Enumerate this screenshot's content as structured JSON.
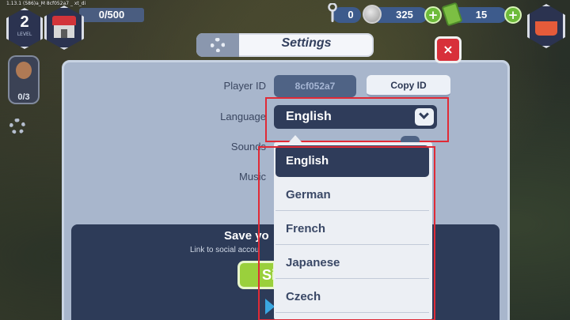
{
  "hud": {
    "version_text": "1.13.1 (586)a_M 8cf052a7 _ xt_di",
    "level_number": "2",
    "level_label": "LEVEL",
    "xp_text": "0/500",
    "wrench_count": "0",
    "coins": "325",
    "cash": "15",
    "plus_label": "+",
    "workers_text": "0/3"
  },
  "settings": {
    "title": "Settings",
    "close_label": "×",
    "player_id_label": "Player ID",
    "player_id_value": "8cf052a7",
    "copy_id_label": "Copy ID",
    "language_label": "Language",
    "language_value": "English",
    "sounds_label": "Sounds",
    "music_label": "Music",
    "language_options": [
      "English",
      "German",
      "French",
      "Japanese",
      "Czech"
    ],
    "selected_index": 0
  },
  "save_card": {
    "title": "Save yo",
    "subtitle": "Link to social accou",
    "signin_label": "Si"
  },
  "colors": {
    "panel": "#a8b6cc",
    "dark_field": "#2f3c5a",
    "highlight_red": "#e02a36",
    "close_red": "#d8303a",
    "plus_green": "#6dbb3a"
  },
  "icons": [
    "wrench-icon",
    "coin-icon",
    "cash-icon",
    "gear-icon",
    "chevron-down-icon",
    "close-icon",
    "basket-icon",
    "play-icon"
  ]
}
